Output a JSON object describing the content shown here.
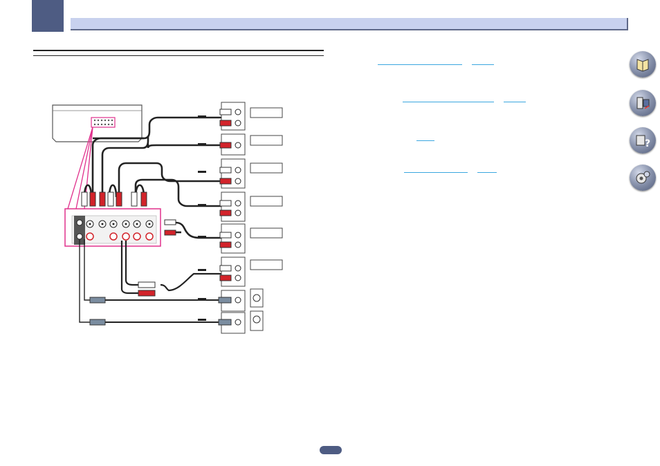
{
  "header": {
    "chapter_tab_color": "#4e5c83",
    "bar_color": "#c8d1ee"
  },
  "diagram": {
    "connection_color": "#e0308c",
    "cable_colors": {
      "white": "#ffffff",
      "red": "#d2232a",
      "gray": "#7b8da0"
    },
    "devices": [
      "av-receiver",
      "component-1",
      "component-2",
      "component-3",
      "component-4",
      "component-5",
      "component-6",
      "speaker-1",
      "speaker-2"
    ]
  },
  "cross_references": [
    "link-1",
    "link-2",
    "link-3",
    "link-4",
    "link-5",
    "link-6",
    "link-7",
    "link-8"
  ],
  "nav_icons": [
    "manual-icon",
    "setup-icon",
    "faq-icon",
    "settings-icon"
  ]
}
